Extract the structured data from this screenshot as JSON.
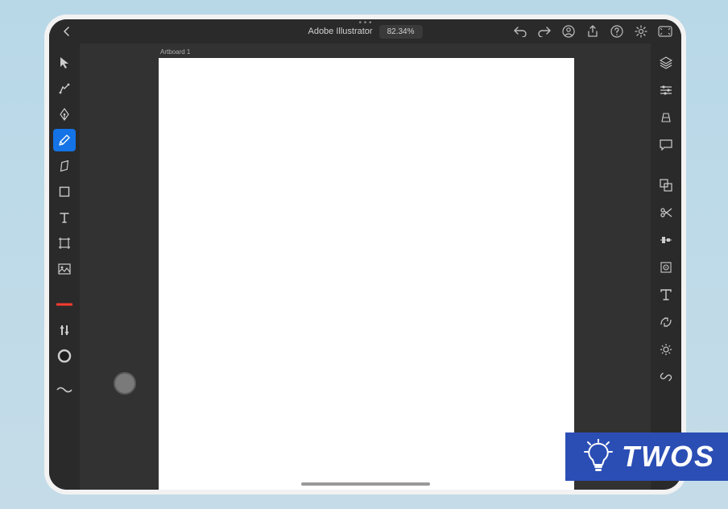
{
  "app": {
    "title": "Adobe Illustrator",
    "zoom_label": "82.34%"
  },
  "artboard": {
    "label": "Artboard 1"
  },
  "topbar_icons": {
    "back": "chevron-left",
    "undo": "undo",
    "redo": "redo",
    "profile": "profile",
    "share": "share",
    "help": "help",
    "settings": "gear",
    "present": "present"
  },
  "left_tools": [
    {
      "name": "selection-tool",
      "selected": false
    },
    {
      "name": "direct-selection-tool",
      "selected": false
    },
    {
      "name": "pen-tool",
      "selected": false
    },
    {
      "name": "pencil-tool",
      "selected": true
    },
    {
      "name": "eraser-tool",
      "selected": false
    },
    {
      "name": "shape-tool",
      "selected": false
    },
    {
      "name": "type-tool",
      "selected": false
    },
    {
      "name": "artboard-tool",
      "selected": false
    },
    {
      "name": "place-image-tool",
      "selected": false
    }
  ],
  "left_props": {
    "stroke_preview": "stroke-swatch",
    "stroke_options": "stroke-options",
    "fill_preview": "fill-swatch",
    "wave": "brush-stroke-preview"
  },
  "right_panels": [
    "layers-panel",
    "properties-panel",
    "transform-panel",
    "comments-panel",
    "pathfinder-panel",
    "scissors-panel",
    "align-panel",
    "precision-panel",
    "type-panel",
    "repeat-panel",
    "guides-panel",
    "link-panel"
  ],
  "watermark": {
    "text": "TWOS"
  }
}
